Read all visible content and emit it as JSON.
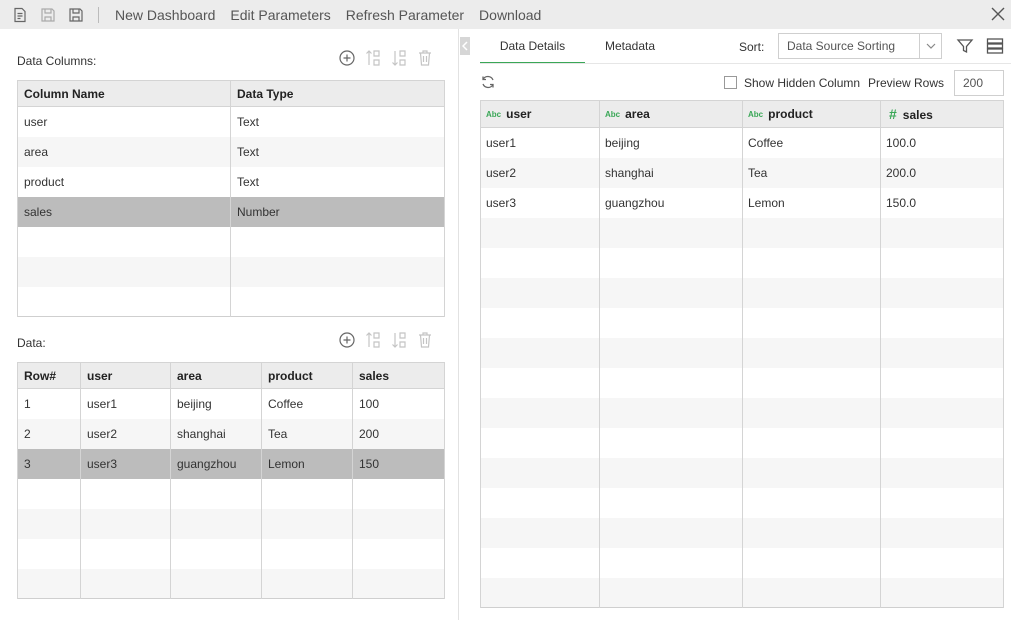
{
  "toolbar": {
    "icons": [
      "new-report-icon",
      "save-icon",
      "save-as-icon"
    ],
    "buttons": [
      "New Dashboard",
      "Edit Parameters",
      "Refresh Parameter",
      "Download"
    ],
    "close_icon": "close-icon"
  },
  "left": {
    "columns_label": "Data Columns:",
    "columns_headers": [
      "Column Name",
      "Data Type"
    ],
    "columns_rows": [
      {
        "name": "user",
        "type": "Text"
      },
      {
        "name": "area",
        "type": "Text"
      },
      {
        "name": "product",
        "type": "Text"
      },
      {
        "name": "sales",
        "type": "Number",
        "selected": true
      }
    ],
    "data_label": "Data:",
    "data_headers": [
      "Row#",
      "user",
      "area",
      "product",
      "sales"
    ],
    "data_rows": [
      [
        "1",
        "user1",
        "beijing",
        "Coffee",
        "100"
      ],
      [
        "2",
        "user2",
        "shanghai",
        "Tea",
        "200"
      ],
      [
        "3",
        "user3",
        "guangzhou",
        "Lemon",
        "150"
      ]
    ],
    "selected_data_row": 3,
    "tool_icons": [
      "add-icon",
      "move-up-icon",
      "move-down-icon",
      "delete-icon"
    ]
  },
  "right": {
    "tabs": [
      "Data Details",
      "Metadata"
    ],
    "active_tab": "Data Details",
    "sort_label": "Sort:",
    "sort_value": "Data Source Sorting",
    "show_hidden_label": "Show Hidden Column",
    "show_hidden_checked": false,
    "preview_rows_label": "Preview Rows",
    "preview_rows_value": "200",
    "headers": [
      {
        "type": "Abc",
        "name": "user"
      },
      {
        "type": "Abc",
        "name": "area"
      },
      {
        "type": "Abc",
        "name": "product"
      },
      {
        "type": "#",
        "name": "sales"
      }
    ],
    "rows": [
      [
        "user1",
        "beijing",
        "Coffee",
        "100.0"
      ],
      [
        "user2",
        "shanghai",
        "Tea",
        "200.0"
      ],
      [
        "user3",
        "guangzhou",
        "Lemon",
        "150.0"
      ]
    ],
    "accent": "#3aa757"
  }
}
